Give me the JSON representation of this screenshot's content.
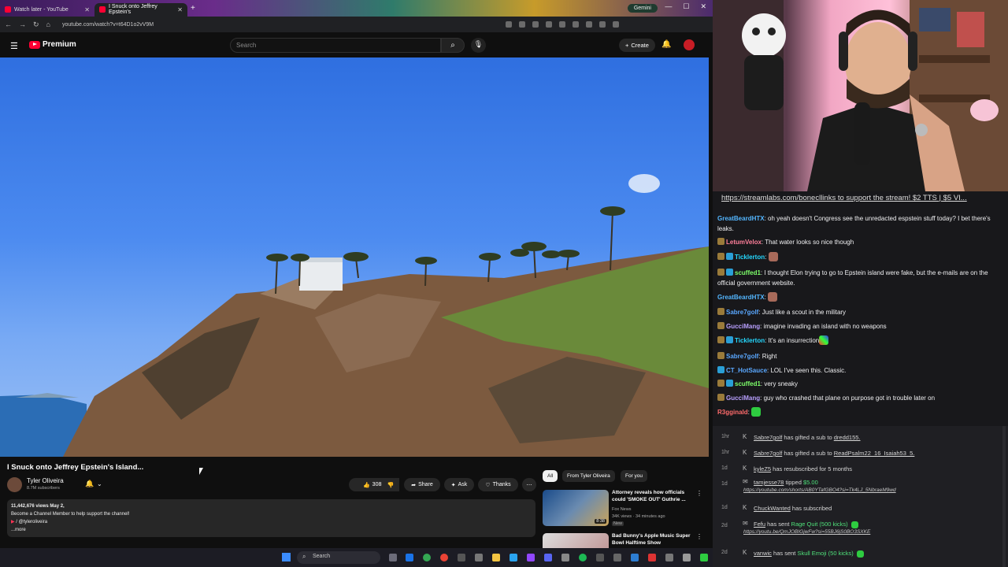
{
  "browser": {
    "tabs": [
      {
        "title": "Watch later - YouTube"
      },
      {
        "title": "I Snuck onto Jeffrey Epstein's"
      }
    ],
    "gemini_label": "Gemini",
    "url": "youtube.com/watch?v=t64D1o2vV9M"
  },
  "youtube": {
    "logo_text": "Premium",
    "search_placeholder": "Search",
    "create_label": "Create",
    "video_title": "I Snuck onto Jeffrey Epstein's Island...",
    "channel": {
      "name": "Tyler Oliveira",
      "subscribers": "8.7M subscribers"
    },
    "actions": {
      "likes": "308K",
      "share": "Share",
      "ask": "Ask",
      "thanks": "Thanks"
    },
    "description": {
      "stats": "11,442,676 views  May 2,",
      "line1": "Become a Channel Member to help support the channel!",
      "line2": "/ @tyleroliveira",
      "more": "...more"
    },
    "chips": [
      "All",
      "From Tyler Oliveira",
      "For you"
    ],
    "recs": [
      {
        "title": "Attorney reveals how officials could 'SMOKE OUT' Guthrie ...",
        "channel": "Fox News",
        "meta": "34K views · 34 minutes ago",
        "badge": "New",
        "duration": "8:38"
      },
      {
        "title": "Bad Bunny's Apple Music Super Bowl Halftime Show",
        "channel": "",
        "meta": "",
        "badge": "",
        "duration": ""
      }
    ]
  },
  "taskbar": {
    "search_label": "Search"
  },
  "chat": {
    "pinned": "https://streamlabs.com/bonecllinks to support the stream! $2 TTS | $5 VI...",
    "messages": [
      {
        "user": "GreatBeardHTX",
        "color": "#53b6ff",
        "text": "oh yeah doesn't Congress see the unredacted espstein stuff today? I bet there's leaks.",
        "badges": []
      },
      {
        "user": "LetumVelox",
        "color": "#ff7f9a",
        "text": "That water looks so nice though",
        "badges": [
          "sub"
        ]
      },
      {
        "user": "Ticklerton",
        "color": "#25d8ff",
        "text": "",
        "badges": [
          "sub",
          "cube"
        ],
        "emote": true
      },
      {
        "user": "scuffed1",
        "color": "#7dff6a",
        "text": "I thought Elon trying to go to Epstein island were fake, but the e-mails are on the official government website.",
        "badges": [
          "sub",
          "cube"
        ]
      },
      {
        "user": "GreatBeardHTX",
        "color": "#53b6ff",
        "text": "",
        "badges": [],
        "emote": true
      },
      {
        "user": "Sabre7golf",
        "color": "#5aa8ff",
        "text": "Just like a scout in the military",
        "badges": [
          "sub"
        ]
      },
      {
        "user": "GucciMang",
        "color": "#b9a0ff",
        "text": "imagine invading an island with no weapons",
        "badges": [
          "sub"
        ]
      },
      {
        "user": "Ticklerton",
        "color": "#25d8ff",
        "text": "It's an insurrection",
        "badges": [
          "sub",
          "cube"
        ],
        "emote": true
      },
      {
        "user": "Sabre7golf",
        "color": "#5aa8ff",
        "text": "Right",
        "badges": [
          "sub"
        ]
      },
      {
        "user": "CT_HotSauce",
        "color": "#5aa8ff",
        "text": "LOL I've seen this. Classic.",
        "badges": [
          "cube"
        ]
      },
      {
        "user": "scuffed1",
        "color": "#7dff6a",
        "text": "very sneaky",
        "badges": [
          "sub",
          "cube"
        ]
      },
      {
        "user": "GucciMang",
        "color": "#b9a0ff",
        "text": "guy who crashed that plane on purpose got in trouble later on",
        "badges": [
          "sub"
        ]
      },
      {
        "user": "R3gginald",
        "color": "#ff6b6b",
        "text": "",
        "badges": [],
        "emote": true
      }
    ]
  },
  "feed": {
    "events": [
      {
        "time": "1hr",
        "user": "Sabre7golf",
        "text": "has gifted a sub to",
        "target": "dredd155."
      },
      {
        "time": "1hr",
        "user": "Sabre7golf",
        "text": "has gifted a sub to",
        "target": "ReadPsalm22_16_Isaiah53_5."
      },
      {
        "time": "1d",
        "user": "kyleZ5",
        "text": "has resubscribed for 5 months",
        "target": ""
      },
      {
        "time": "1d",
        "user": "tamjesse78",
        "text": "tipped",
        "target": "$5.00",
        "link": "https://youtube.com/shorts/AB0YTafGBO4?si=Tk4LJ_5NbraeM9wd"
      },
      {
        "time": "1d",
        "user": "ChuckWanted",
        "text": "has subscribed",
        "target": ""
      },
      {
        "time": "2d",
        "user": "Fefu",
        "text": "has sent",
        "target": "Rage Quit (500 kicks)",
        "link": "https://youtu.be/QmJOBIGjwFw?si=55BJ6jS0BO3SXKE"
      },
      {
        "time": "2d",
        "user": "vanwic",
        "text": "has sent",
        "target": "Skull Emoji (50 kicks)"
      }
    ]
  }
}
